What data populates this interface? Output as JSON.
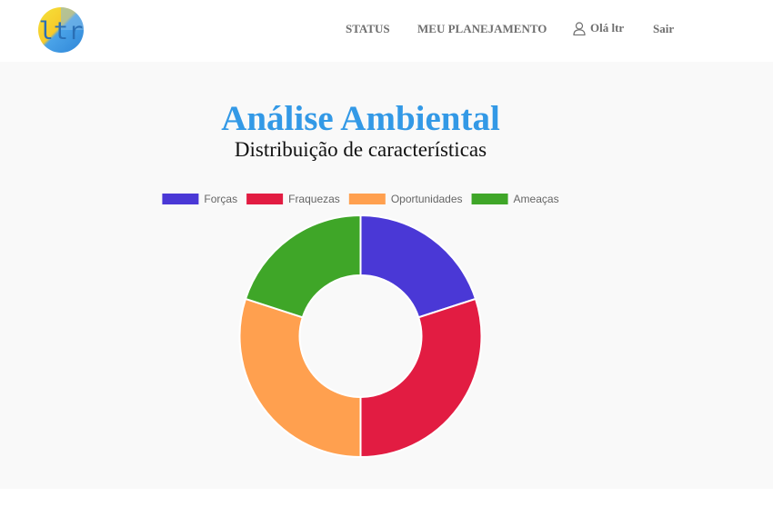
{
  "header": {
    "logo_text": "ltr",
    "nav": {
      "status": "STATUS",
      "planning": "MEU PLANEJAMENTO",
      "greeting": "Olá ltr",
      "logout": "Sair"
    }
  },
  "main": {
    "title": "Análise Ambiental",
    "subtitle": "Distribuição de características"
  },
  "colors": {
    "title": "#3399e6",
    "forcas": "#4a38d6",
    "fraquezas": "#e21c42",
    "oportunidades": "#ffa04f",
    "ameacas": "#3fa628"
  },
  "chart_data": {
    "type": "doughnut",
    "categories": [
      "Forças",
      "Fraquezas",
      "Oportunidades",
      "Ameaças"
    ],
    "values": [
      2,
      3,
      3,
      2
    ],
    "colors": [
      "#4a38d6",
      "#e21c42",
      "#ffa04f",
      "#3fa628"
    ],
    "legend": "top"
  }
}
